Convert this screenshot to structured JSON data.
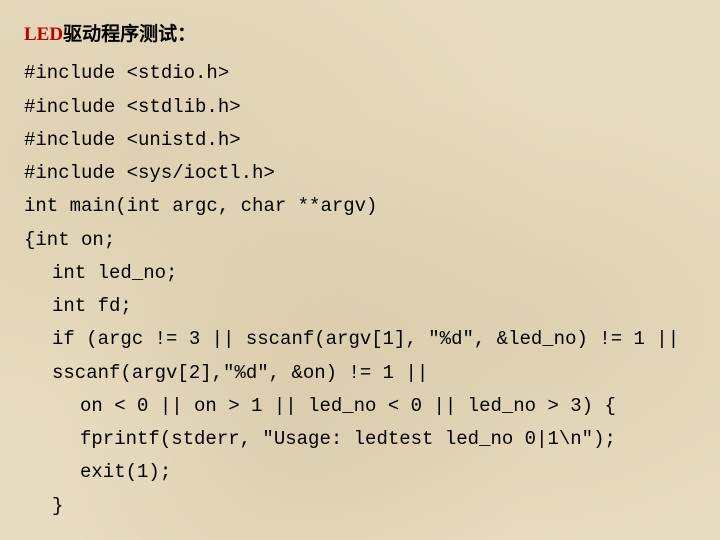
{
  "title": {
    "led": "LED",
    "rest": "驱动程序测试："
  },
  "lines": {
    "l0": "#include <stdio.h>",
    "l1": "#include <stdlib.h>",
    "l2": "#include <unistd.h>",
    "l3": "#include <sys/ioctl.h>",
    "l4": "int main(int argc, char **argv)",
    "l5": "{int on;",
    "l6": "int led_no;",
    "l7": "int fd;",
    "l8": "if (argc != 3 || sscanf(argv[1], \"%d\", &led_no) != 1 ||",
    "l9": "sscanf(argv[2],\"%d\", &on) != 1 ||",
    "l10": "on < 0 || on > 1 || led_no < 0 || led_no > 3) {",
    "l11": "fprintf(stderr, \"Usage: ledtest led_no 0|1\\n\");",
    "l12": "exit(1);",
    "l13": "}"
  }
}
